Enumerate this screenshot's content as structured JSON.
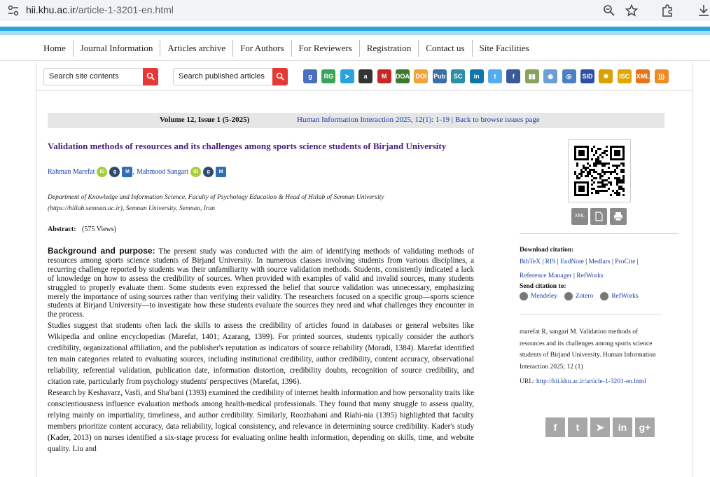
{
  "browser": {
    "url_host": "hii.khu.ac.ir",
    "url_path": "/article-1-3201-en.html"
  },
  "nav": {
    "items": [
      "Home",
      "Journal Information",
      "Articles archive",
      "For Authors",
      "For Reviewers",
      "Registration",
      "Contact us",
      "Site Facilities"
    ]
  },
  "search": {
    "site_placeholder": "Search site contents",
    "articles_placeholder": "Search published articles"
  },
  "toolbar_icons": [
    {
      "name": "google-scholar-icon",
      "label": "g",
      "color": "#4a6fbf"
    },
    {
      "name": "researchgate-icon",
      "label": "RG",
      "color": "#3aa35a"
    },
    {
      "name": "telegram-icon",
      "label": "➤",
      "color": "#2aa3dc"
    },
    {
      "name": "amazon-icon",
      "label": "a",
      "color": "#333333"
    },
    {
      "name": "mendeley-icon",
      "label": "M",
      "color": "#c62828"
    },
    {
      "name": "doaj-icon",
      "label": "DOAJ",
      "color": "#3d7a2e"
    },
    {
      "name": "doi-icon",
      "label": "DOI",
      "color": "#f2a33a"
    },
    {
      "name": "pubmed-icon",
      "label": "Pub",
      "color": "#3b6ea8"
    },
    {
      "name": "scopus-icon",
      "label": "SC",
      "color": "#2b8fa8"
    },
    {
      "name": "linkedin-icon",
      "label": "in",
      "color": "#0e76a8"
    },
    {
      "name": "twitter-icon",
      "label": "t",
      "color": "#55acee"
    },
    {
      "name": "facebook-icon",
      "label": "f",
      "color": "#3b5998"
    },
    {
      "name": "library-icon",
      "label": "▮▮",
      "color": "#8aa35c"
    },
    {
      "name": "eye-icon",
      "label": "◉",
      "color": "#6c9fd4"
    },
    {
      "name": "magiran-icon",
      "label": "◎",
      "color": "#4a7fc1"
    },
    {
      "name": "sid-icon",
      "label": "SID",
      "color": "#2e4fa3"
    },
    {
      "name": "isc-star-icon",
      "label": "✹",
      "color": "#d8a300"
    },
    {
      "name": "isc-icon",
      "label": "ISC",
      "color": "#e0a800"
    },
    {
      "name": "xml-icon",
      "label": "XML",
      "color": "#e8731a"
    },
    {
      "name": "rss-icon",
      "label": ")))",
      "color": "#f08a24"
    }
  ],
  "volume": {
    "title": "Volume 12, Issue 1 (5-2025)",
    "citation": "Human Information Interaction 2025, 12(1): 1-19",
    "separator": "|",
    "back_link": "Back to browse issues page"
  },
  "article": {
    "title": "Validation methods of resources and its challenges among sports science students of Birjand University",
    "author1": "Rahman Marefat",
    "author2": "Mahmood Sangari",
    "comma": ",",
    "affiliation": "Department of Knowledge and Information Science, Faculty of Psychology Education & Head of Hiilab of Semnan University (https://hiilab.semnan.ac.ir), Semnan University, Semnan, Iran",
    "abstract_label": "Abstract:",
    "views": "(575 Views)",
    "bg_label": "Background and purpose:",
    "bg_text": " The present study was conducted with the aim of identifying methods of validating methods of resources among sports science students of Birjand University. In numerous classes involving students from various disciplines, a recurring challenge reported by students was their unfamiliarity with source validation methods. Students, consistently indicated a lack of knowledge on how to assess the credibility of sources. When provided with examples of valid and invalid sources, many students struggled to properly evaluate them. Some students even expressed the belief that source validation was unnecessary, emphasizing merely the importance of using sources rather than verifying their validity. The researchers focused on a specific group—sports science students at Birjand University—to investigate how these students evaluate the sources they need and what challenges they encounter in the process.",
    "para2": "Studies suggest that students often lack the skills to assess the credibility of articles found in databases or general websites like Wikipedia and online encyclopedias (Marefat, 1401; Azarang, 1399). For printed sources, students typically consider the author's credibility, organizational affiliation, and the publisher's reputation as indicators of source reliability (Moradi, 1384). Marefat identified ten main categories related to evaluating sources, including institutional credibility, author credibility, content accuracy, observational reliability, referential validation, publication date, information distortion, credibility doubts, recognition of source credibility, and citation rate, particularly from psychology students' perspectives (Marefat, 1396).",
    "para3": "Research by Keshavarz, Vasfi, and Sha'bani (1393) examined the credibility of internet health information and how personality traits like conscientiousness influence evaluation methods among health-medical professionals. They found that many struggle to assess quality, relying mainly on impartiality, timeliness, and author credibility. Similarly, Roozbahani and Riahi-nia (1395) highlighted that faculty members prioritize content accuracy, data reliability, logical consistency, and relevance in determining source credibility. Kader's study (Kader, 2013) on nurses identified a six-stage process for evaluating online health information, depending on skills, time, and website quality. Liu and"
  },
  "sidebar": {
    "xml_btn": "XML",
    "download_label": "Download citation:",
    "dl_links": [
      "BibTeX",
      "RIS",
      "EndNote",
      "Medlars",
      "ProCite",
      "Reference Manager",
      "RefWorks"
    ],
    "send_label": "Send citation to:",
    "send_links": [
      "Mendeley",
      "Zotero",
      "RefWorks"
    ],
    "ref_text": "marefat R, sangari M. Validation methods of resources and its challenges among sports science students of Birjand University. Human Information Interaction 2025; 12 (1)",
    "url_label": "URL: ",
    "url": "http://hii.khu.ac.ir/article-1-3201-en.html"
  },
  "share": [
    {
      "name": "facebook-share-icon",
      "label": "f"
    },
    {
      "name": "twitter-share-icon",
      "label": "t"
    },
    {
      "name": "telegram-share-icon",
      "label": "➤"
    },
    {
      "name": "linkedin-share-icon",
      "label": "in"
    },
    {
      "name": "googleplus-share-icon",
      "label": "g+"
    }
  ]
}
